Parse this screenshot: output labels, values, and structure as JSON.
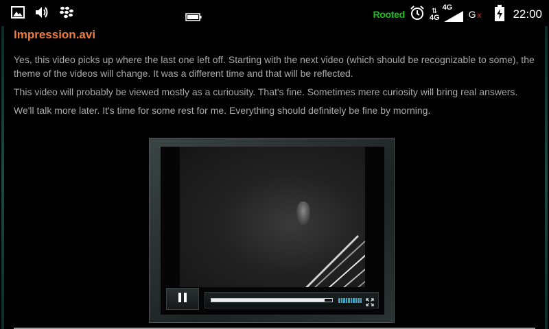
{
  "status_bar": {
    "left_icons": [
      "gallery-icon",
      "volume-icon",
      "blackberry-messenger-icon"
    ],
    "center_icon": "battery-saver-icon",
    "rooted_label": "Rooted",
    "alarm_icon": "alarm-clock-icon",
    "network_top": "4G",
    "network_bottom": "4G",
    "signal_icon": "signal-icon",
    "g_label": "G",
    "x_label": "x",
    "battery_icon": "battery-charging-icon",
    "time": "22:00",
    "colors": {
      "rooted": "#18c21a",
      "x": "#e3241c"
    }
  },
  "article": {
    "title": "Impression.avi",
    "paragraphs": [
      "Yes, this video picks up where the last one left off.  Starting with the next video (which should be recognizable to some), the theme of the videos will change.  It was a different time and that will be reflected.",
      "This video will probably be viewed mostly as a curiousity.  That's fine.  Sometimes mere curiosity will bring real answers.",
      "We'll talk more later.  It's time for some rest for me.  Everything should definitely be fine by morning."
    ],
    "colors": {
      "title": "#f07b3b",
      "text": "#a9a9a9"
    }
  },
  "video_player": {
    "pause_icon": "pause-icon",
    "progress_fraction": 0.94,
    "volume_bars": 10,
    "fullscreen_icon": "fullscreen-icon",
    "accent": "#38a8c8"
  }
}
